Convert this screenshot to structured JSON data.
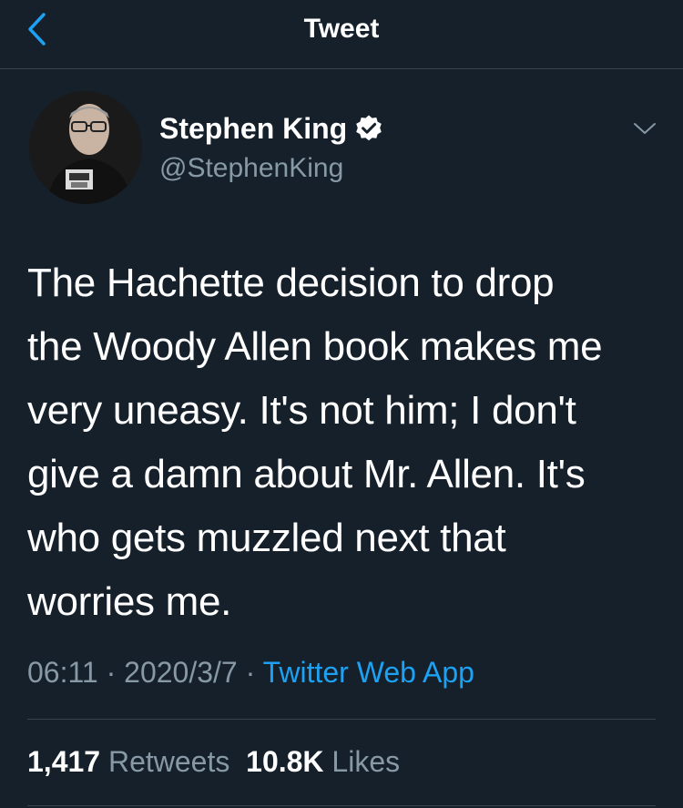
{
  "header": {
    "title": "Tweet"
  },
  "author": {
    "name": "Stephen King",
    "handle": "@StephenKing",
    "verified": true
  },
  "tweet": {
    "text": "The Hachette decision to drop\nthe Woody Allen book makes me\nvery uneasy. It's not him; I don't\ngive a damn about Mr. Allen.  It's\nwho gets muzzled next that\nworries me."
  },
  "meta": {
    "time": "06:11",
    "separator": " · ",
    "date": "2020/3/7",
    "source": "Twitter Web App"
  },
  "stats": {
    "retweets_count": "1,417",
    "retweets_label": "Retweets",
    "likes_count": "10.8K",
    "likes_label": "Likes"
  },
  "colors": {
    "background": "#15202b",
    "accent": "#1da1f2",
    "secondary_text": "#8899a6",
    "divider": "#38444d"
  }
}
